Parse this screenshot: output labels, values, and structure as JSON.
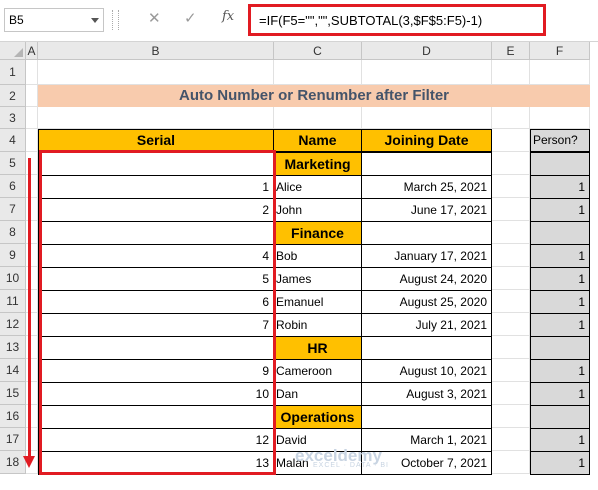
{
  "formula_bar": {
    "name_box": "B5",
    "cancel_icon": "close-icon",
    "enter_icon": "check-icon",
    "fx_label": "fx",
    "formula": "=IF(F5=\"\",\"\",SUBTOTAL(3,$F$5:F5)-1)"
  },
  "columns": [
    "A",
    "B",
    "C",
    "D",
    "E",
    "F"
  ],
  "rows": [
    "1",
    "2",
    "3",
    "4",
    "5",
    "6",
    "7",
    "8",
    "9",
    "10",
    "11",
    "12",
    "13",
    "14",
    "15",
    "16",
    "17",
    "18"
  ],
  "title": "Auto Number or Renumber after Filter",
  "table": {
    "headers": {
      "serial": "Serial",
      "name": "Name",
      "date": "Joining Date",
      "person": "Person?"
    },
    "rows": [
      {
        "serial": "",
        "name": "Marketing",
        "date": "",
        "person": "",
        "dept": true
      },
      {
        "serial": "1",
        "name": "Alice",
        "date": "March 25, 2021",
        "person": "1"
      },
      {
        "serial": "2",
        "name": "John",
        "date": "June 17, 2021",
        "person": "1"
      },
      {
        "serial": "",
        "name": "Finance",
        "date": "",
        "person": "",
        "dept": true
      },
      {
        "serial": "4",
        "name": "Bob",
        "date": "January 17, 2021",
        "person": "1"
      },
      {
        "serial": "5",
        "name": "James",
        "date": "August 24, 2020",
        "person": "1"
      },
      {
        "serial": "6",
        "name": "Emanuel",
        "date": "August 25, 2020",
        "person": "1"
      },
      {
        "serial": "7",
        "name": "Robin",
        "date": "July 21, 2021",
        "person": "1"
      },
      {
        "serial": "",
        "name": "HR",
        "date": "",
        "person": "",
        "dept": true
      },
      {
        "serial": "9",
        "name": "Cameroon",
        "date": "August 10, 2021",
        "person": "1"
      },
      {
        "serial": "10",
        "name": "Dan",
        "date": "August 3, 2021",
        "person": "1"
      },
      {
        "serial": "",
        "name": "Operations",
        "date": "",
        "person": "",
        "dept": true
      },
      {
        "serial": "12",
        "name": "David",
        "date": "March 1, 2021",
        "person": "1"
      },
      {
        "serial": "13",
        "name": "Malan",
        "date": "October 7, 2021",
        "person": "1"
      }
    ]
  },
  "watermark": {
    "brand": "exceldemy",
    "tagline": "EXCEL · DATA · BI"
  },
  "colors": {
    "header_fill": "#ffc000",
    "title_fill": "#f8cbad",
    "title_text": "#44546a",
    "highlight": "#e11b22",
    "helper_fill": "#d9d9d9"
  }
}
